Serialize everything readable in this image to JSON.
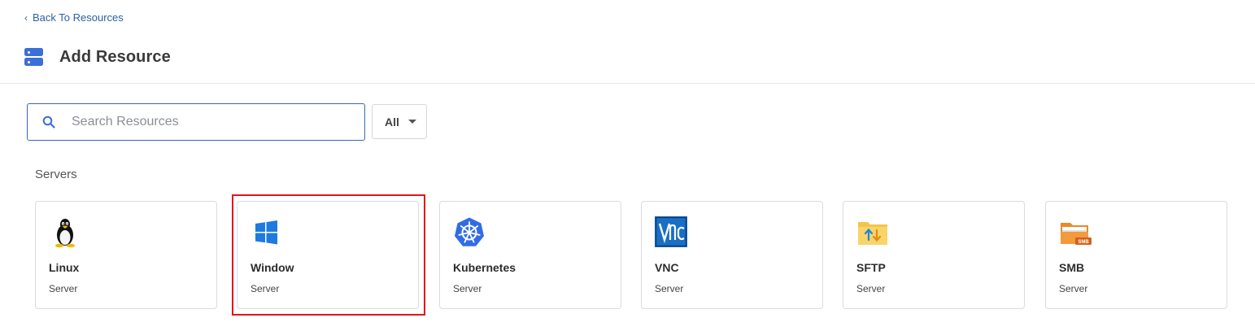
{
  "nav": {
    "back_label": "Back To Resources"
  },
  "header": {
    "title": "Add Resource",
    "icon": "server-stack-icon",
    "accent": "#3b6fd8"
  },
  "search": {
    "placeholder": "Search Resources",
    "value": ""
  },
  "filter": {
    "selected": "All"
  },
  "section": {
    "title": "Servers"
  },
  "resources": [
    {
      "name": "Linux",
      "type": "Server",
      "icon": "linux-tux-icon"
    },
    {
      "name": "Window",
      "type": "Server",
      "icon": "windows-logo-icon"
    },
    {
      "name": "Kubernetes",
      "type": "Server",
      "icon": "kubernetes-wheel-icon"
    },
    {
      "name": "VNC",
      "type": "Server",
      "icon": "vnc-logo-icon"
    },
    {
      "name": "SFTP",
      "type": "Server",
      "icon": "sftp-folder-icon"
    },
    {
      "name": "SMB",
      "type": "Server",
      "icon": "smb-folder-icon"
    }
  ],
  "highlight_color": "#e3141c"
}
